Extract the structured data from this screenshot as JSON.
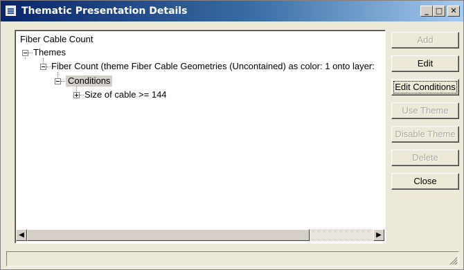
{
  "window": {
    "title": "Thematic Presentation Details"
  },
  "title_controls": {
    "minimize": "_",
    "maximize": "□",
    "close": "✕"
  },
  "tree": {
    "root": "Fiber Cable Count",
    "themes": "Themes",
    "theme_item": "Fiber Count (theme Fiber Cable Geometries (Uncontained) as color: 1 onto layer:",
    "conditions": "Conditions",
    "condition_item": "Size of cable >= 144"
  },
  "scrollbar": {
    "left_arrow": "◀",
    "right_arrow": "▶"
  },
  "buttons": {
    "add": "Add",
    "edit": "Edit",
    "edit_conditions": "Edit Conditions",
    "use_theme": "Use Theme",
    "disable_theme": "Disable Theme",
    "delete": "Delete",
    "close": "Close"
  },
  "button_states": {
    "add": "disabled",
    "edit": "enabled",
    "edit_conditions": "enabled (focused)",
    "use_theme": "disabled",
    "disable_theme": "disabled",
    "delete": "disabled",
    "close": "enabled"
  },
  "icons": {
    "window": "list-window-icon",
    "expanded": "collapse-box-icon",
    "collapsed": "expand-box-icon"
  },
  "colors": {
    "titlebar_start": "#0a246a",
    "titlebar_end": "#a6caf0",
    "window_bg": "#ece9d8",
    "disabled_text": "#aca899",
    "selection_bg": "#d4d0c8"
  }
}
